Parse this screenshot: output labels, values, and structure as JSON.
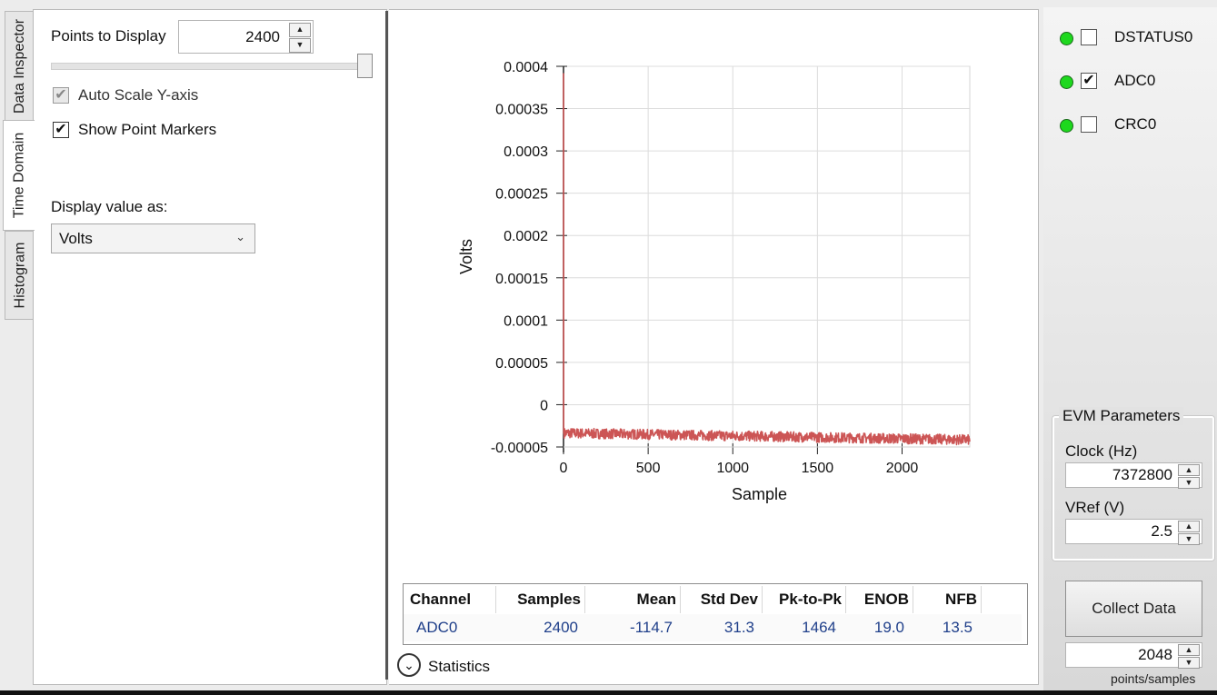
{
  "tabs": [
    {
      "label": "Data Inspector",
      "active": false
    },
    {
      "label": "Time Domain",
      "active": true
    },
    {
      "label": "Histogram",
      "active": false
    }
  ],
  "controls": {
    "points_label": "Points to Display",
    "points_value": "2400",
    "slider_level": 1.0,
    "auto_scale_label": "Auto Scale Y-axis",
    "auto_scale_checked": true,
    "auto_scale_enabled": false,
    "show_markers_label": "Show Point Markers",
    "show_markers_checked": true,
    "display_as_label": "Display value as:",
    "display_as_value": "Volts"
  },
  "chart_data": {
    "type": "line",
    "title": "",
    "xlabel": "Sample",
    "ylabel": "Volts",
    "xlim": [
      0,
      2400
    ],
    "ylim": [
      -5e-05,
      0.0004
    ],
    "x_ticks": [
      "0",
      "500",
      "1000",
      "1500",
      "2000"
    ],
    "x_tick_values": [
      0,
      500,
      1000,
      1500,
      2000
    ],
    "y_ticks": [
      "0.0004",
      "0.00035",
      "0.0003",
      "0.00025",
      "0.0002",
      "0.00015",
      "0.0001",
      "0.00005",
      "0",
      "-0.00005"
    ],
    "y_tick_values": [
      0.0004,
      0.00035,
      0.0003,
      0.00025,
      0.0002,
      0.00015,
      0.0001,
      5e-05,
      0,
      -5e-05
    ],
    "grid": true,
    "series": [
      {
        "color": "#cc5555",
        "spike": {
          "x": [
            0,
            1,
            2,
            3
          ],
          "y": [
            0.000392,
            -3.35e-05,
            -3.4e-05,
            -3.5e-05
          ]
        },
        "x": [
          0,
          300,
          600,
          900,
          1200,
          1500,
          1800,
          2100,
          2400
        ],
        "y": [
          -3.35e-05,
          -3.45e-05,
          -3.55e-05,
          -3.65e-05,
          -3.75e-05,
          -3.85e-05,
          -3.95e-05,
          -4.05e-05,
          -4.15e-05
        ],
        "noise_band": 6e-06
      }
    ]
  },
  "stats": {
    "headers": [
      "Channel",
      "Samples",
      "Mean",
      "Std Dev",
      "Pk-to-Pk",
      "ENOB",
      "NFB"
    ],
    "row": [
      "ADC0",
      "2400",
      "-114.7",
      "31.3",
      "1464",
      "19.0",
      "13.5"
    ],
    "toggle_label": "Statistics"
  },
  "channels": [
    {
      "label": "DSTATUS0",
      "checked": false,
      "led": "#1ed81e"
    },
    {
      "label": "ADC0",
      "checked": true,
      "led": "#1ed81e"
    },
    {
      "label": "CRC0",
      "checked": false,
      "led": "#1ed81e"
    }
  ],
  "evm": {
    "title": "EVM Parameters",
    "clock_label": "Clock (Hz)",
    "clock_value": "7372800",
    "vref_label": "VRef (V)",
    "vref_value": "2.5"
  },
  "collect": {
    "button_label": "Collect Data",
    "samples_value": "2048",
    "samples_caption": "points/samples"
  }
}
